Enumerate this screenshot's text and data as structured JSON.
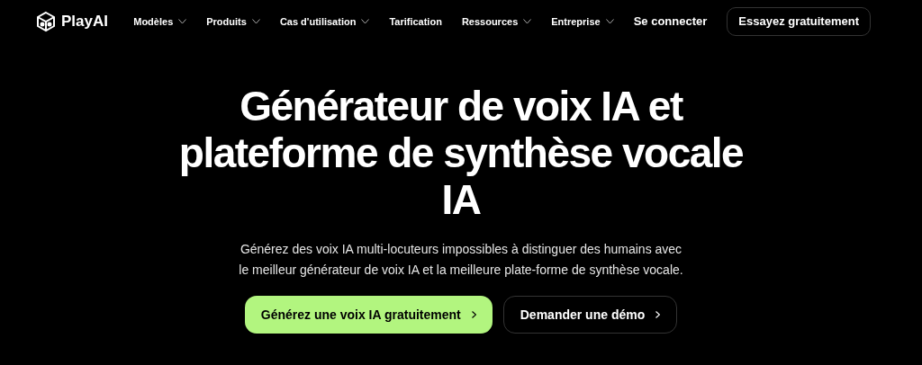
{
  "brand": {
    "name": "PlayAI"
  },
  "nav": [
    {
      "label": "Modèles",
      "dropdown": true
    },
    {
      "label": "Produits",
      "dropdown": true
    },
    {
      "label": "Cas d'utilisation",
      "dropdown": true
    },
    {
      "label": "Tarification",
      "dropdown": false
    },
    {
      "label": "Ressources",
      "dropdown": true
    },
    {
      "label": "Entreprise",
      "dropdown": true
    }
  ],
  "login": "Se connecter",
  "try_button": "Essayez gratuitement",
  "hero": {
    "title_lines": [
      "Générateur de voix IA et",
      "plateforme de synthèse vocale",
      "IA"
    ],
    "subtitle": "Générez des voix IA multi-locuteurs impossibles à distinguer des humains avec le meilleur générateur de voix IA et la meilleure plate-forme de synthèse vocale.",
    "buttons": [
      {
        "label": "Générez une voix IA gratuitement",
        "kind": "primary"
      },
      {
        "label": "Demander une démo",
        "kind": "secondary"
      }
    ]
  }
}
